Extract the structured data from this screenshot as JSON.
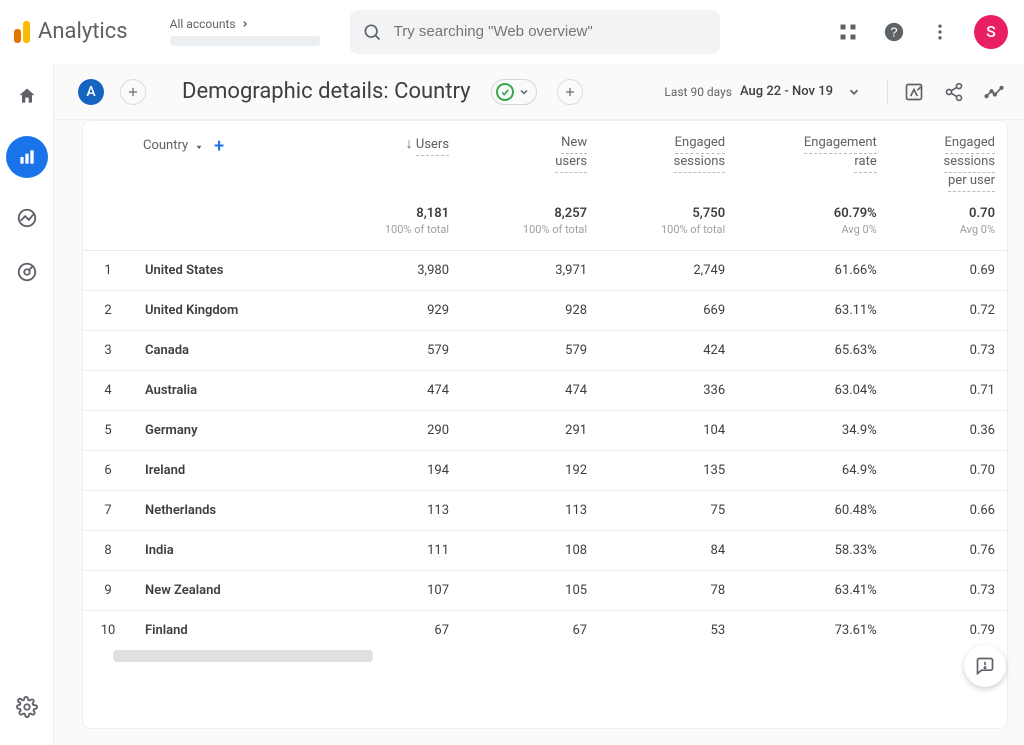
{
  "topbar": {
    "product_name": "Analytics",
    "accounts_label": "All accounts",
    "search_placeholder": "Try searching \"Web overview\"",
    "avatar_initial": "S"
  },
  "report": {
    "title": "Demographic details: Country",
    "badge_letter": "A",
    "date_preset": "Last 90 days",
    "date_range": "Aug 22 - Nov 19"
  },
  "table": {
    "dimension_label": "Country",
    "columns": [
      {
        "key": "users",
        "label": "Users",
        "sorted": true
      },
      {
        "key": "new_users",
        "label_lines": [
          "New",
          "users"
        ]
      },
      {
        "key": "engaged_sessions",
        "label_lines": [
          "Engaged",
          "sessions"
        ]
      },
      {
        "key": "engagement_rate",
        "label_lines": [
          "Engagement",
          "rate"
        ]
      },
      {
        "key": "eng_sess_per_user",
        "label_lines": [
          "Engaged",
          "sessions",
          "per user"
        ]
      }
    ],
    "summary": {
      "users": {
        "value": "8,181",
        "sub": "100% of total"
      },
      "new_users": {
        "value": "8,257",
        "sub": "100% of total"
      },
      "engaged_sessions": {
        "value": "5,750",
        "sub": "100% of total"
      },
      "engagement_rate": {
        "value": "60.79%",
        "sub": "Avg 0%"
      },
      "eng_sess_per_user": {
        "value": "0.70",
        "sub": "Avg 0%"
      }
    },
    "rows": [
      {
        "idx": 1,
        "name": "United States",
        "users": "3,980",
        "new_users": "3,971",
        "engaged_sessions": "2,749",
        "engagement_rate": "61.66%",
        "eng_sess_per_user": "0.69"
      },
      {
        "idx": 2,
        "name": "United Kingdom",
        "users": "929",
        "new_users": "928",
        "engaged_sessions": "669",
        "engagement_rate": "63.11%",
        "eng_sess_per_user": "0.72"
      },
      {
        "idx": 3,
        "name": "Canada",
        "users": "579",
        "new_users": "579",
        "engaged_sessions": "424",
        "engagement_rate": "65.63%",
        "eng_sess_per_user": "0.73"
      },
      {
        "idx": 4,
        "name": "Australia",
        "users": "474",
        "new_users": "474",
        "engaged_sessions": "336",
        "engagement_rate": "63.04%",
        "eng_sess_per_user": "0.71"
      },
      {
        "idx": 5,
        "name": "Germany",
        "users": "290",
        "new_users": "291",
        "engaged_sessions": "104",
        "engagement_rate": "34.9%",
        "eng_sess_per_user": "0.36"
      },
      {
        "idx": 6,
        "name": "Ireland",
        "users": "194",
        "new_users": "192",
        "engaged_sessions": "135",
        "engagement_rate": "64.9%",
        "eng_sess_per_user": "0.70"
      },
      {
        "idx": 7,
        "name": "Netherlands",
        "users": "113",
        "new_users": "113",
        "engaged_sessions": "75",
        "engagement_rate": "60.48%",
        "eng_sess_per_user": "0.66"
      },
      {
        "idx": 8,
        "name": "India",
        "users": "111",
        "new_users": "108",
        "engaged_sessions": "84",
        "engagement_rate": "58.33%",
        "eng_sess_per_user": "0.76"
      },
      {
        "idx": 9,
        "name": "New Zealand",
        "users": "107",
        "new_users": "105",
        "engaged_sessions": "78",
        "engagement_rate": "63.41%",
        "eng_sess_per_user": "0.73"
      },
      {
        "idx": 10,
        "name": "Finland",
        "users": "67",
        "new_users": "67",
        "engaged_sessions": "53",
        "engagement_rate": "73.61%",
        "eng_sess_per_user": "0.79"
      }
    ]
  }
}
